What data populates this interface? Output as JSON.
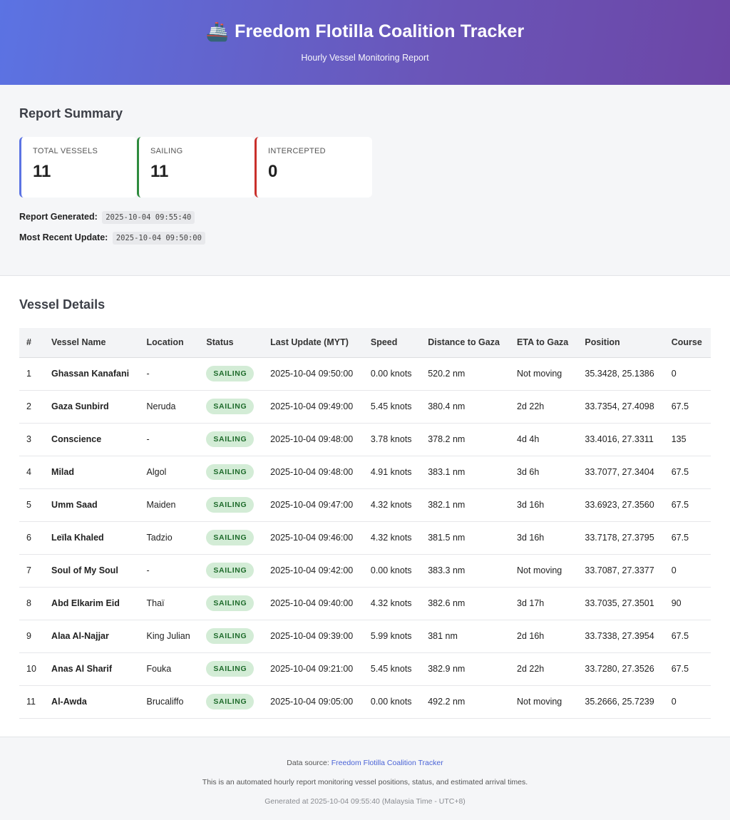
{
  "header": {
    "icon": "ship-icon",
    "icon_glyph": "🚢",
    "title": "Freedom Flotilla Coalition Tracker",
    "subtitle": "Hourly Vessel Monitoring Report"
  },
  "summary": {
    "title": "Report Summary",
    "cards": [
      {
        "label": "TOTAL VESSELS",
        "value": "11",
        "accent": "#5b73e3"
      },
      {
        "label": "SAILING",
        "value": "11",
        "accent": "#2e8b3e"
      },
      {
        "label": "INTERCEPTED",
        "value": "0",
        "accent": "#c9302c"
      }
    ],
    "report_generated_label": "Report Generated:",
    "report_generated_value": "2025-10-04 09:55:40",
    "recent_update_label": "Most Recent Update:",
    "recent_update_value": "2025-10-04 09:50:00"
  },
  "details": {
    "title": "Vessel Details",
    "columns": [
      "#",
      "Vessel Name",
      "Location",
      "Status",
      "Last Update (MYT)",
      "Speed",
      "Distance to Gaza",
      "ETA to Gaza",
      "Position",
      "Course"
    ],
    "rows": [
      [
        "1",
        "Ghassan Kanafani",
        "-",
        "SAILING",
        "2025-10-04 09:50:00",
        "0.00 knots",
        "520.2 nm",
        "Not moving",
        "35.3428, 25.1386",
        "0"
      ],
      [
        "2",
        "Gaza Sunbird",
        "Neruda",
        "SAILING",
        "2025-10-04 09:49:00",
        "5.45 knots",
        "380.4 nm",
        "2d 22h",
        "33.7354, 27.4098",
        "67.5"
      ],
      [
        "3",
        "Conscience",
        "-",
        "SAILING",
        "2025-10-04 09:48:00",
        "3.78 knots",
        "378.2 nm",
        "4d 4h",
        "33.4016, 27.3311",
        "135"
      ],
      [
        "4",
        "Milad",
        "Algol",
        "SAILING",
        "2025-10-04 09:48:00",
        "4.91 knots",
        "383.1 nm",
        "3d 6h",
        "33.7077, 27.3404",
        "67.5"
      ],
      [
        "5",
        "Umm Saad",
        "Maiden",
        "SAILING",
        "2025-10-04 09:47:00",
        "4.32 knots",
        "382.1 nm",
        "3d 16h",
        "33.6923, 27.3560",
        "67.5"
      ],
      [
        "6",
        "Leïla Khaled",
        "Tadzio",
        "SAILING",
        "2025-10-04 09:46:00",
        "4.32 knots",
        "381.5 nm",
        "3d 16h",
        "33.7178, 27.3795",
        "67.5"
      ],
      [
        "7",
        "Soul of My Soul",
        "-",
        "SAILING",
        "2025-10-04 09:42:00",
        "0.00 knots",
        "383.3 nm",
        "Not moving",
        "33.7087, 27.3377",
        "0"
      ],
      [
        "8",
        "Abd Elkarim Eid",
        "Thaï",
        "SAILING",
        "2025-10-04 09:40:00",
        "4.32 knots",
        "382.6 nm",
        "3d 17h",
        "33.7035, 27.3501",
        "90"
      ],
      [
        "9",
        "Alaa Al-Najjar",
        "King Julian",
        "SAILING",
        "2025-10-04 09:39:00",
        "5.99 knots",
        "381 nm",
        "2d 16h",
        "33.7338, 27.3954",
        "67.5"
      ],
      [
        "10",
        "Anas Al Sharif",
        "Fouka",
        "SAILING",
        "2025-10-04 09:21:00",
        "5.45 knots",
        "382.9 nm",
        "2d 22h",
        "33.7280, 27.3526",
        "67.5"
      ],
      [
        "11",
        "Al-Awda",
        "Brucaliffo",
        "SAILING",
        "2025-10-04 09:05:00",
        "0.00 knots",
        "492.2 nm",
        "Not moving",
        "35.2666, 25.7239",
        "0"
      ]
    ]
  },
  "footer": {
    "source_prefix": "Data source:",
    "source_link": "Freedom Flotilla Coalition Tracker",
    "note": "This is an automated hourly report monitoring vessel positions, status, and estimated arrival times.",
    "generated": "Generated at 2025-10-04 09:55:40 (Malaysia Time - UTC+8)"
  }
}
